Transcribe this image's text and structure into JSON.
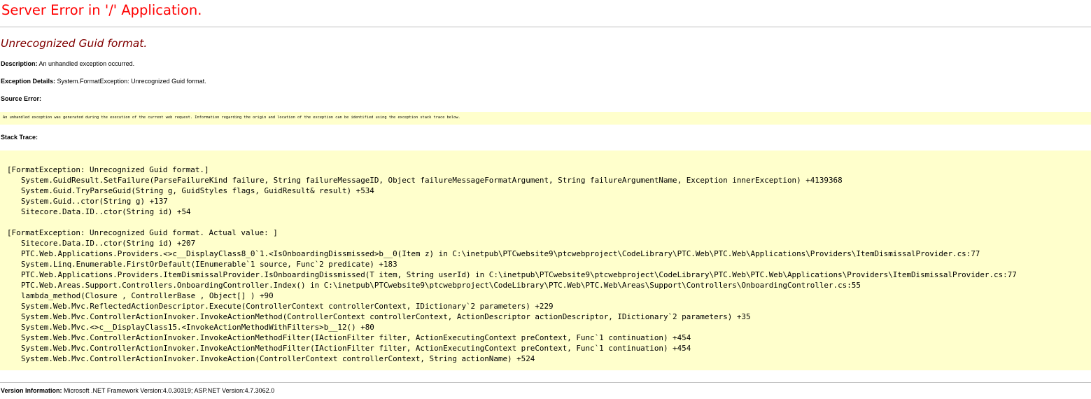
{
  "page_title": "Server Error in '/' Application.",
  "error_message": "Unrecognized Guid format.",
  "description": {
    "label": "Description:",
    "text": "An unhandled exception occurred."
  },
  "exception_details": {
    "label": "Exception Details:",
    "text": "System.FormatException: Unrecognized Guid format."
  },
  "source_error": {
    "label": "Source Error:",
    "text": "An unhandled exception was generated during the execution of the current web request. Information regarding the origin and location of the exception can be identified using the exception stack trace below."
  },
  "stack_trace": {
    "label": "Stack Trace:",
    "lines": [
      "[FormatException: Unrecognized Guid format.]",
      "System.GuidResult.SetFailure(ParseFailureKind failure, String failureMessageID, Object failureMessageFormatArgument, String failureArgumentName, Exception innerException) +4139368",
      "System.Guid.TryParseGuid(String g, GuidStyles flags, GuidResult& result) +534",
      "System.Guid..ctor(String g) +137",
      "Sitecore.Data.ID..ctor(String id) +54",
      "",
      "[FormatException: Unrecognized Guid format. Actual value: ]",
      "Sitecore.Data.ID..ctor(String id) +207",
      "PTC.Web.Applications.Providers.<>c__DisplayClass8_0`1.<IsOnboardingDissmissed>b__0(Item z) in C:\\inetpub\\PTCwebsite9\\ptcwebproject\\CodeLibrary\\PTC.Web\\PTC.Web\\Applications\\Providers\\ItemDismissalProvider.cs:77",
      "System.Linq.Enumerable.FirstOrDefault(IEnumerable`1 source, Func`2 predicate) +183",
      "PTC.Web.Applications.Providers.ItemDismissalProvider.IsOnboardingDissmissed(T item, String userId) in C:\\inetpub\\PTCwebsite9\\ptcwebproject\\CodeLibrary\\PTC.Web\\PTC.Web\\Applications\\Providers\\ItemDismissalProvider.cs:77",
      "PTC.Web.Areas.Support.Controllers.OnboardingController.Index() in C:\\inetpub\\PTCwebsite9\\ptcwebproject\\CodeLibrary\\PTC.Web\\PTC.Web\\Areas\\Support\\Controllers\\OnboardingController.cs:55",
      "lambda_method(Closure , ControllerBase , Object[] ) +90",
      "System.Web.Mvc.ReflectedActionDescriptor.Execute(ControllerContext controllerContext, IDictionary`2 parameters) +229",
      "System.Web.Mvc.ControllerActionInvoker.InvokeActionMethod(ControllerContext controllerContext, ActionDescriptor actionDescriptor, IDictionary`2 parameters) +35",
      "System.Web.Mvc.<>c__DisplayClass15.<InvokeActionMethodWithFilters>b__12() +80",
      "System.Web.Mvc.ControllerActionInvoker.InvokeActionMethodFilter(IActionFilter filter, ActionExecutingContext preContext, Func`1 continuation) +454",
      "System.Web.Mvc.ControllerActionInvoker.InvokeActionMethodFilter(IActionFilter filter, ActionExecutingContext preContext, Func`1 continuation) +454",
      "System.Web.Mvc.ControllerActionInvoker.InvokeAction(ControllerContext controllerContext, String actionName) +524"
    ]
  },
  "version_information": {
    "label": "Version Information:",
    "text": "Microsoft .NET Framework Version:4.0.30319; ASP.NET Version:4.7.3062.0"
  },
  "colors": {
    "title": "#ff0000",
    "error_message": "#800000",
    "code_background": "#ffffcc",
    "rule": "#c0c0c0"
  }
}
